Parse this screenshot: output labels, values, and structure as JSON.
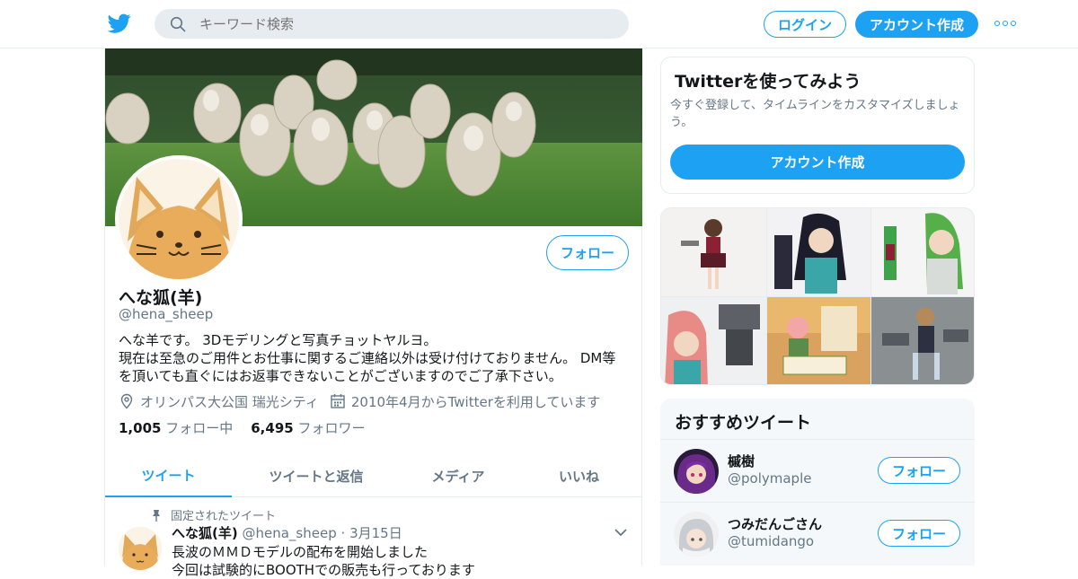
{
  "colors": {
    "accent": "#1da1f2",
    "text": "#14171a",
    "muted": "#657786",
    "border": "#e6ecf0"
  },
  "header": {
    "logo_icon": "twitter-bird-icon",
    "search_placeholder": "キーワード検索",
    "login_label": "ログイン",
    "signup_label": "アカウント作成",
    "more_icon": "more-dots-icon"
  },
  "profile": {
    "name": "へな狐(羊)",
    "handle": "@hena_sheep",
    "follow_label": "フォロー",
    "bio_lines": [
      "へな羊です。 3Dモデリングと写真チョットヤルヨ。",
      "現在は至急のご用件とお仕事に関するご連絡以外は受け付けておりません。 DM等",
      "を頂いても直ぐにはお返事できないことがございますのでご了承下さい。"
    ],
    "location": "オリンパス大公国 瑞光シティ",
    "joined": "2010年4月からTwitterを利用しています",
    "following_count": "1,005",
    "following_label": "フォロー中",
    "followers_count": "6,495",
    "followers_label": "フォロワー"
  },
  "tabs": [
    "ツイート",
    "ツイートと返信",
    "メディア",
    "いいね"
  ],
  "pinned_tweet": {
    "pinned_label": "固定されたツイート",
    "name": "へな狐(羊)",
    "handle": "@hena_sheep",
    "date": "3月15日",
    "text_line1": "長波のＭＭＤモデルの配布を開始しました",
    "text_line2": "今回は試験的にBOOTHでの販売も行っております"
  },
  "signup_card": {
    "title": "Twitterを使ってみよう",
    "subtitle": "今すぐ登録して、タイムラインをカスタマイズしましょう。",
    "cta": "アカウント作成"
  },
  "recommended": {
    "title": "おすすめツイート",
    "follow_label": "フォロー",
    "users": [
      {
        "name": "槭樹",
        "handle": "@polymaple"
      },
      {
        "name": "つみだんごさん",
        "handle": "@tumidango"
      }
    ]
  }
}
